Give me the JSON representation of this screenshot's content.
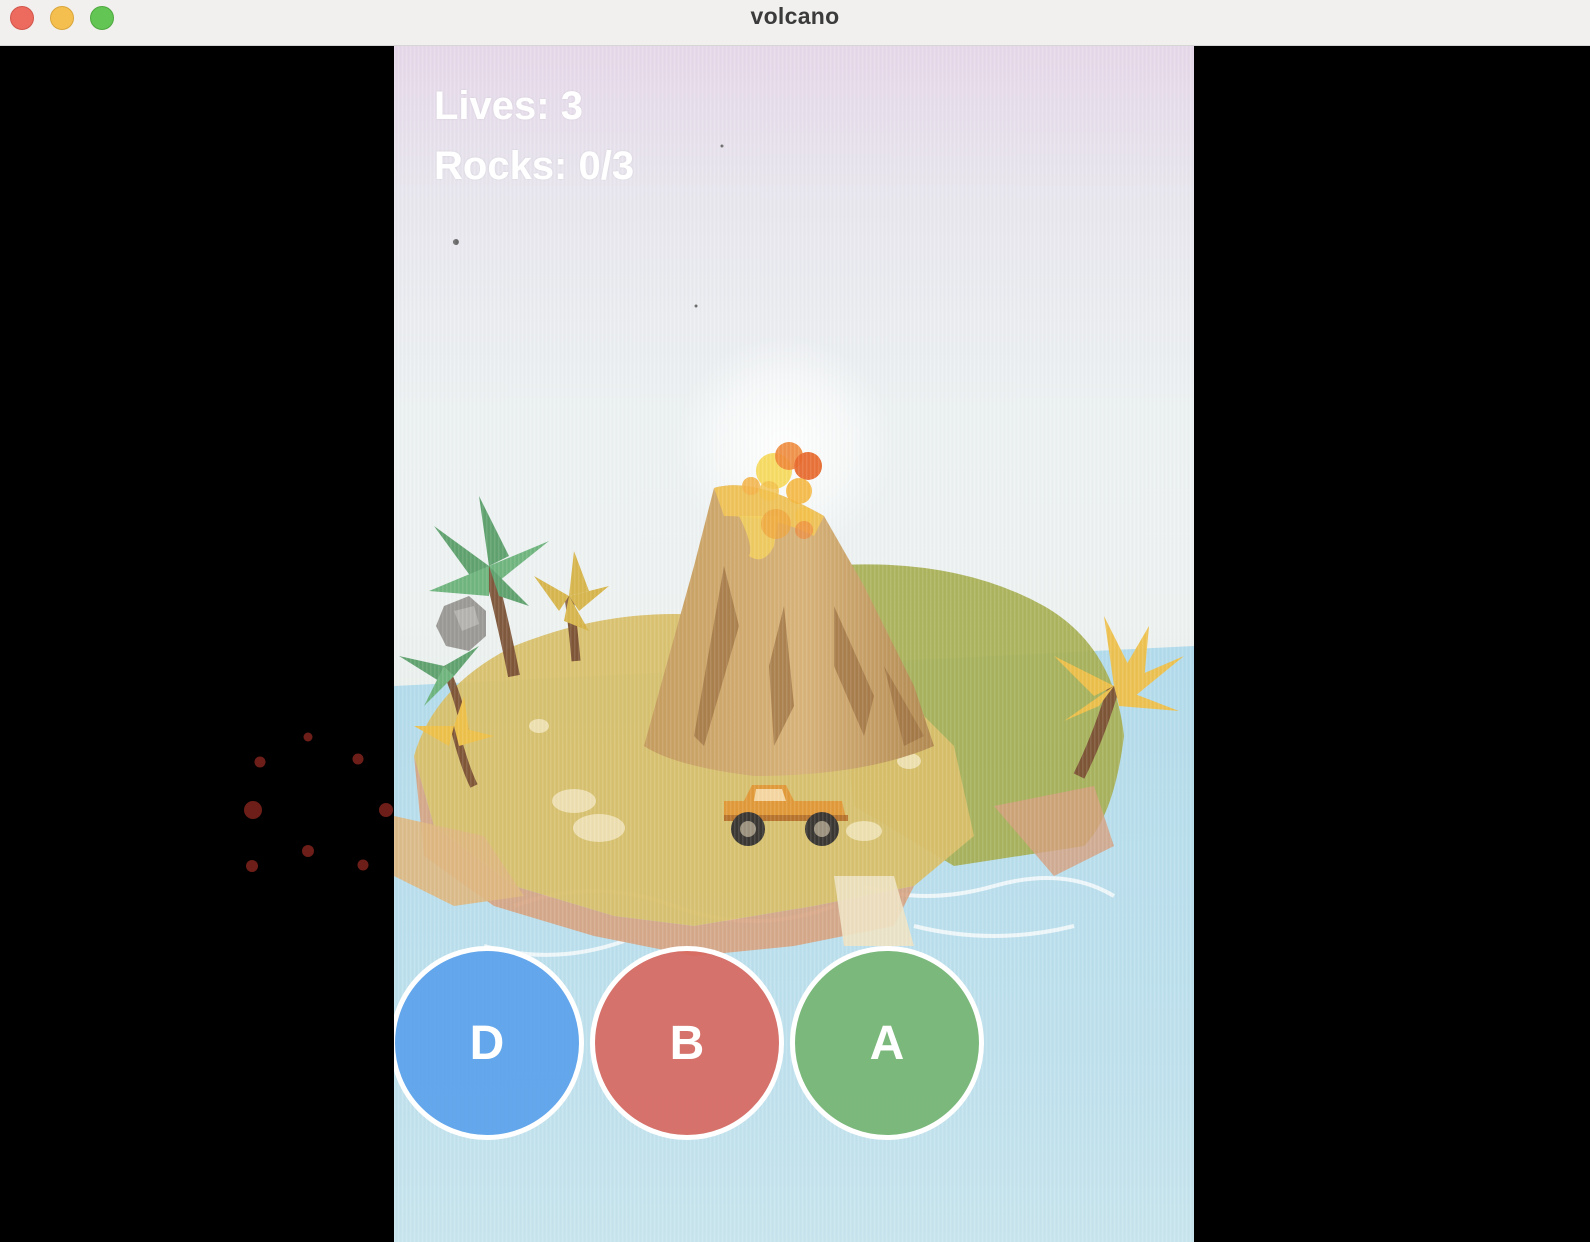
{
  "window": {
    "title": "volcano"
  },
  "hud": {
    "lives_text": "Lives: 3",
    "rocks_text": "Rocks: 0/3"
  },
  "answer_buttons": [
    {
      "label": "D",
      "color": "#5ea3eb"
    },
    {
      "label": "B",
      "color": "#d76860"
    },
    {
      "label": "A",
      "color": "#75b472"
    }
  ],
  "colors": {
    "titlebar": "#f1f0ef",
    "close": "#ed6a5e",
    "minimize": "#f5bf4f",
    "maximize": "#62c554",
    "letterbox": "#000000"
  }
}
